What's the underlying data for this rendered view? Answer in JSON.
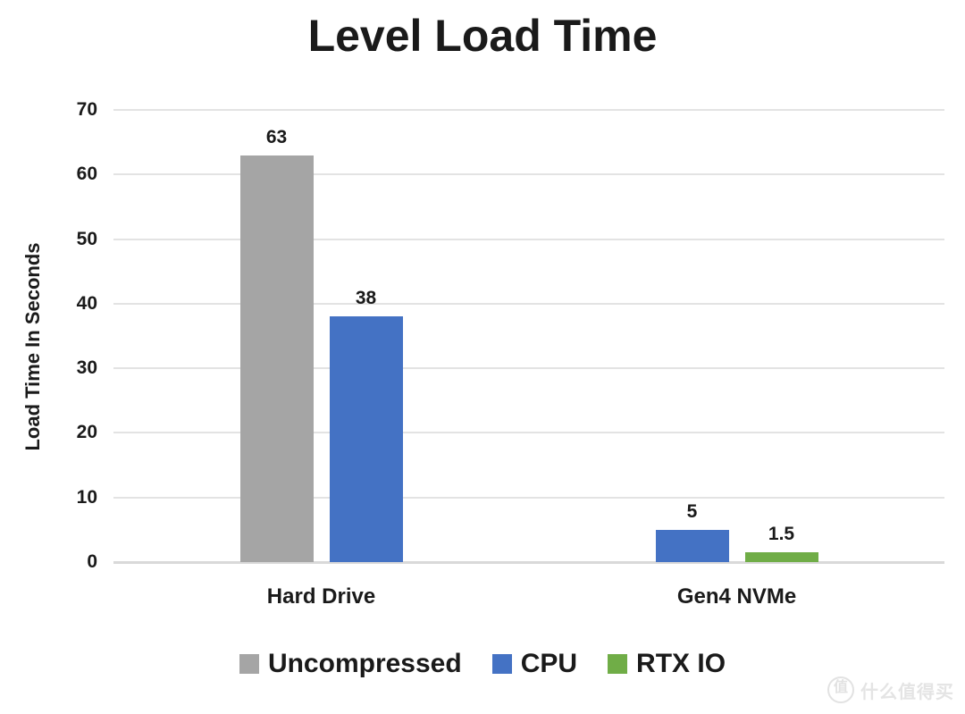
{
  "chart_data": {
    "type": "bar",
    "title": "Level Load Time",
    "xlabel": "",
    "ylabel": "Load Time In Seconds",
    "categories": [
      "Hard Drive",
      "Gen4 NVMe"
    ],
    "series": [
      {
        "name": "Uncompressed",
        "color": "#A5A5A5",
        "values": [
          63,
          null
        ],
        "labels": [
          "63",
          ""
        ]
      },
      {
        "name": "CPU",
        "color": "#4472C4",
        "values": [
          38,
          5
        ],
        "labels": [
          "38",
          "5"
        ]
      },
      {
        "name": "RTX IO",
        "color": "#70AD47",
        "values": [
          null,
          1.5
        ],
        "labels": [
          "",
          "1.5"
        ]
      }
    ],
    "ylim": [
      0,
      70
    ],
    "y_ticks": [
      "0",
      "10",
      "20",
      "30",
      "40",
      "50",
      "60",
      "70"
    ],
    "y_tick_values": [
      0,
      10,
      20,
      30,
      40,
      50,
      60,
      70
    ],
    "grid": true,
    "legend_position": "bottom",
    "annotations": []
  },
  "watermark": {
    "mark": "值",
    "text": "什么值得买"
  }
}
